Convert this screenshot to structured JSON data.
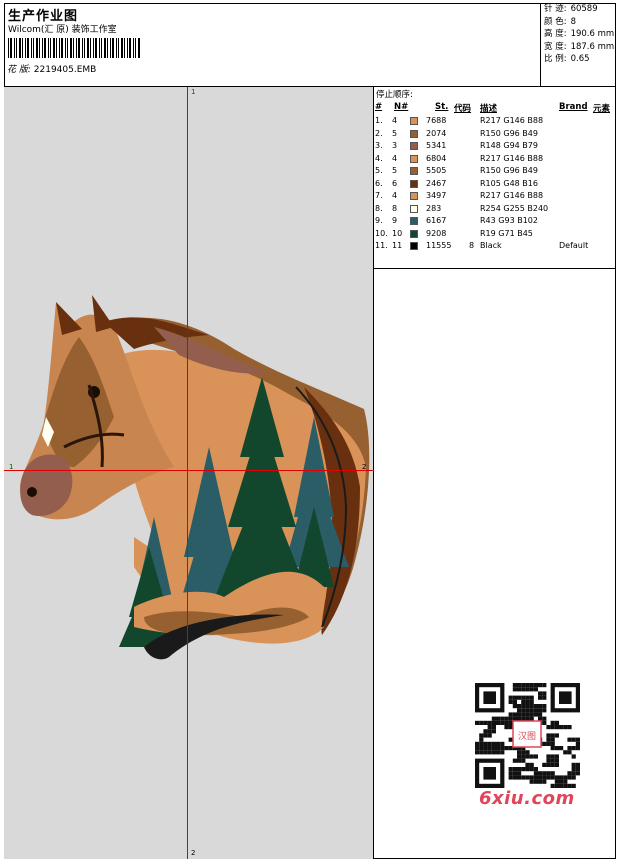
{
  "header": {
    "title": "生产作业图",
    "company": "Wilcom(汇 原) 装饰工作室",
    "design_label": "花 版:",
    "design_value": "2219405.EMB",
    "info": [
      {
        "label": "针 迹:",
        "value": "60589"
      },
      {
        "label": "颜 色:",
        "value": "8"
      },
      {
        "label": "高 度:",
        "value": "190.6 mm"
      },
      {
        "label": "宽 度:",
        "value": "187.6 mm"
      },
      {
        "label": "比 例:",
        "value": "0.65"
      }
    ]
  },
  "preview": {
    "marker_top": "1",
    "marker_bottom": "2",
    "marker_left": "1",
    "marker_right": "2",
    "colors": {
      "crosshair": "#e00000",
      "background": "#d9d9d9"
    }
  },
  "stop_sequence": {
    "title": "停止顺序:",
    "columns": {
      "hash": "#",
      "n": "N#",
      "st": "St.",
      "code": "代码",
      "desc": "描述",
      "brand": "Brand",
      "element": "元素"
    },
    "rows": [
      {
        "num": "1.",
        "n": "4",
        "color": "#d99258",
        "st": "7688",
        "code": "",
        "desc": "R217 G146 B88",
        "brand": ""
      },
      {
        "num": "2.",
        "n": "5",
        "color": "#966031",
        "st": "2074",
        "code": "",
        "desc": "R150 G96 B49",
        "brand": ""
      },
      {
        "num": "3.",
        "n": "3",
        "color": "#945e4f",
        "st": "5341",
        "code": "",
        "desc": "R148 G94 B79",
        "brand": ""
      },
      {
        "num": "4.",
        "n": "4",
        "color": "#d99258",
        "st": "6804",
        "code": "",
        "desc": "R217 G146 B88",
        "brand": ""
      },
      {
        "num": "5.",
        "n": "5",
        "color": "#966031",
        "st": "5505",
        "code": "",
        "desc": "R150 G96 B49",
        "brand": ""
      },
      {
        "num": "6.",
        "n": "6",
        "color": "#693010",
        "st": "2467",
        "code": "",
        "desc": "R105 G48 B16",
        "brand": ""
      },
      {
        "num": "7.",
        "n": "4",
        "color": "#d99258",
        "st": "3497",
        "code": "",
        "desc": "R217 G146 B88",
        "brand": ""
      },
      {
        "num": "8.",
        "n": "8",
        "color": "#feffF0",
        "st": "283",
        "code": "",
        "desc": "R254 G255 B240",
        "brand": ""
      },
      {
        "num": "9.",
        "n": "9",
        "color": "#2b5d66",
        "st": "6167",
        "code": "",
        "desc": "R43 G93 B102",
        "brand": ""
      },
      {
        "num": "10.",
        "n": "10",
        "color": "#13472d",
        "st": "9208",
        "code": "",
        "desc": "R19 G71 B45",
        "brand": ""
      },
      {
        "num": "11.",
        "n": "11",
        "color": "#000000",
        "st": "11555",
        "code": "8",
        "desc": "Black",
        "brand": "Default"
      }
    ]
  },
  "watermark": {
    "site": "6xiu.com",
    "stamp": "汉图"
  }
}
